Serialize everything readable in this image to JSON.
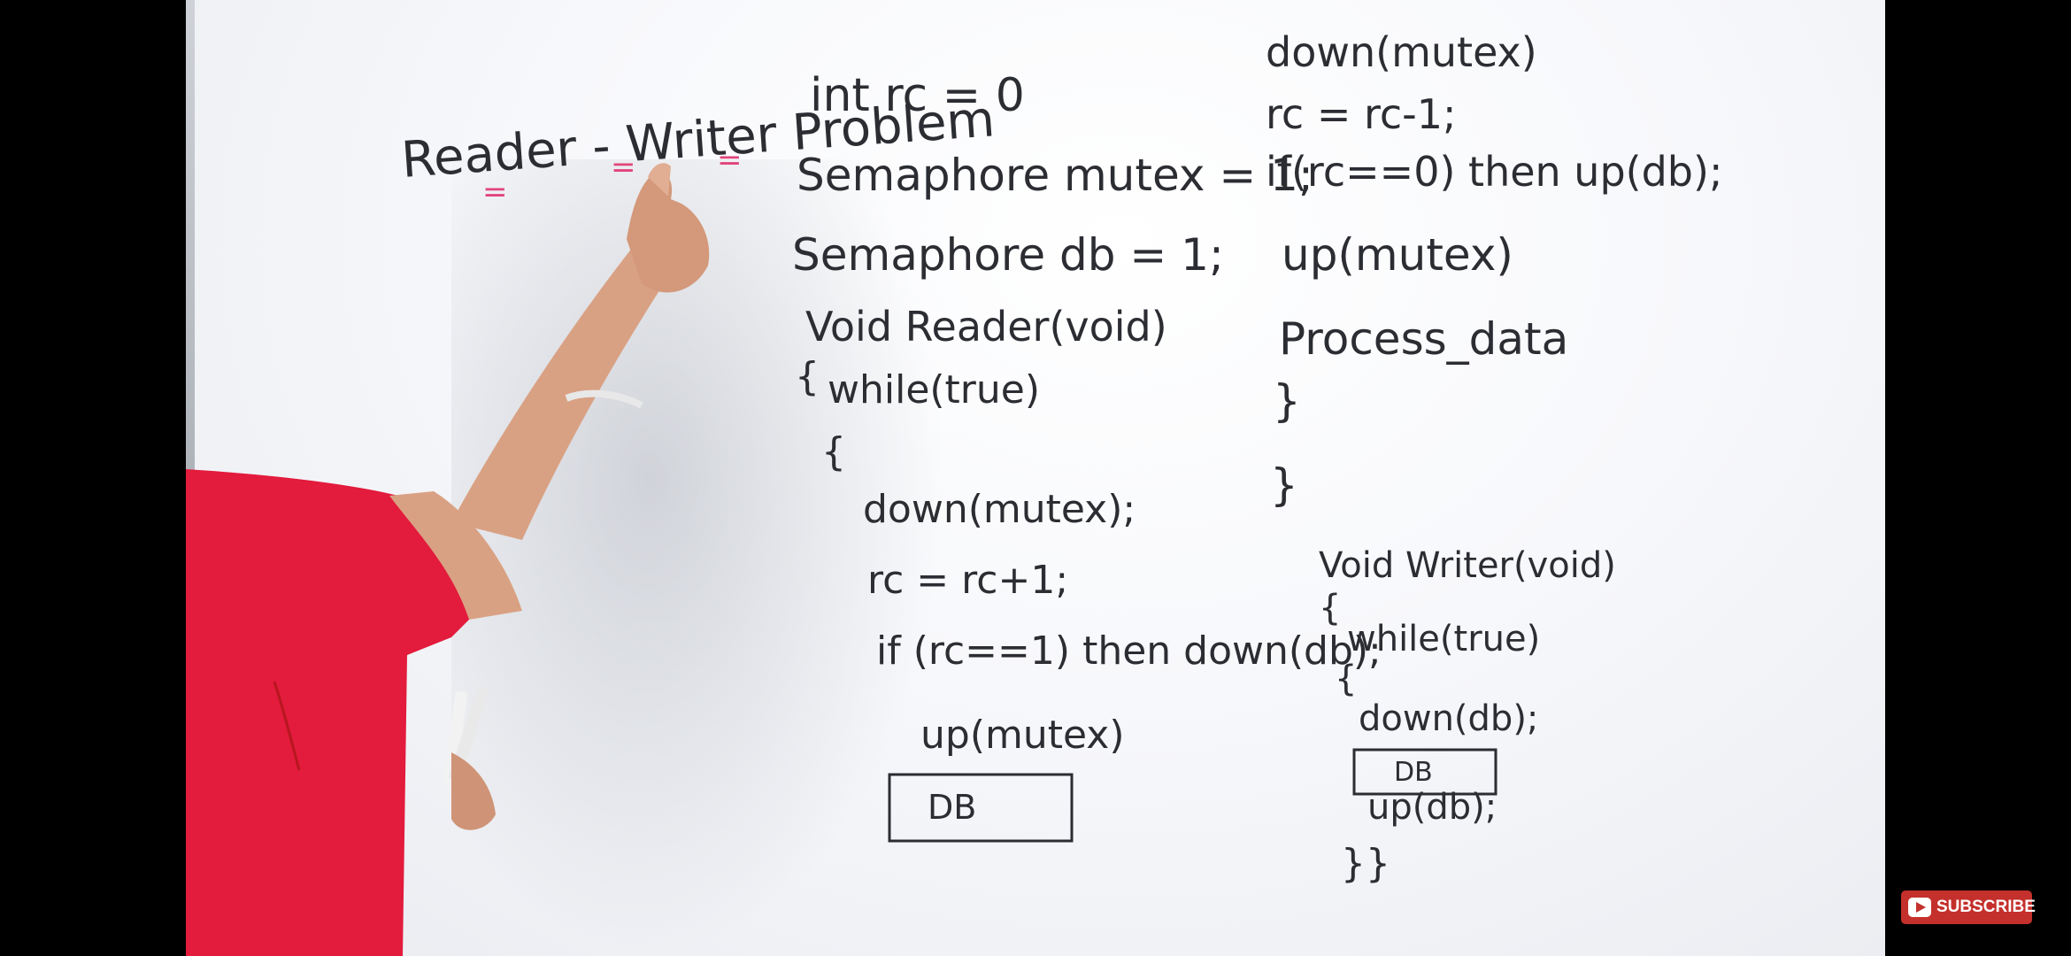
{
  "board": {
    "title": "Reader - Writer Problem",
    "decl": [
      "int rc = 0",
      "Semaphore mutex = 1;",
      "Semaphore db = 1;"
    ],
    "reader_header": "Void Reader(void)",
    "reader_open1": "{",
    "reader_while": "while(true)",
    "reader_open2": "{",
    "reader_down_mutex": "down(mutex);",
    "reader_rc_inc": "rc = rc+1;",
    "reader_if1": "if (rc==1) then down(db);",
    "reader_up_mutex1": "up(mutex)",
    "reader_db": "DB",
    "reader_down_mutex2": "down(mutex)",
    "reader_rc_dec": "rc = rc-1;",
    "reader_if2": "if(rc==0) then up(db);",
    "reader_up_mutex2": "up(mutex)",
    "reader_process": "Process_data",
    "reader_close1": "}",
    "reader_close2": "}",
    "writer_header": "Void Writer(void)",
    "writer_open1": "{",
    "writer_while": "while(true)",
    "writer_open2": "{",
    "writer_down_db": "down(db);",
    "writer_db": "DB",
    "writer_up_db": "up(db);",
    "writer_close": "}}"
  },
  "overlay": {
    "subscribe_label": "SUBSCRIBE",
    "subscribe_icon": "play-icon"
  },
  "colors": {
    "marker": "#2b2d33",
    "underline": "#e0457a",
    "shirt": "#e31b3c",
    "subscribe_bg": "#c4302b"
  }
}
